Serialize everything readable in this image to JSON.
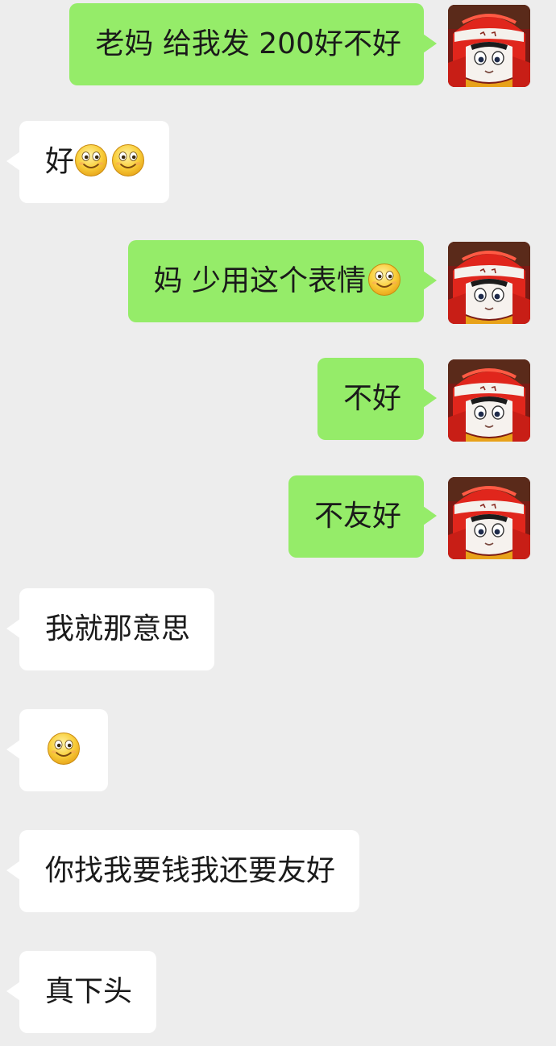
{
  "messages": [
    {
      "from": "me",
      "text": "老妈 给我发 200好不好",
      "emoji_count": 0
    },
    {
      "from": "them",
      "text": "好",
      "emoji_count": 2
    },
    {
      "from": "me",
      "text": "妈 少用这个表情",
      "emoji_count": 1
    },
    {
      "from": "me",
      "text": "不好",
      "emoji_count": 0
    },
    {
      "from": "me",
      "text": "不友好",
      "emoji_count": 0
    },
    {
      "from": "them",
      "text": "我就那意思",
      "emoji_count": 0
    },
    {
      "from": "them",
      "text": "",
      "emoji_count": 1
    },
    {
      "from": "them",
      "text": "你找我要钱我还要友好",
      "emoji_count": 0
    },
    {
      "from": "them",
      "text": "真下头",
      "emoji_count": 0
    }
  ],
  "icons": {
    "emoji": "smile-emoji-icon",
    "avatar": "red-hat-cartoon-avatar"
  },
  "colors": {
    "background": "#ededed",
    "my_bubble": "#95ec69",
    "their_bubble": "#ffffff",
    "text": "#1a1a1a"
  }
}
